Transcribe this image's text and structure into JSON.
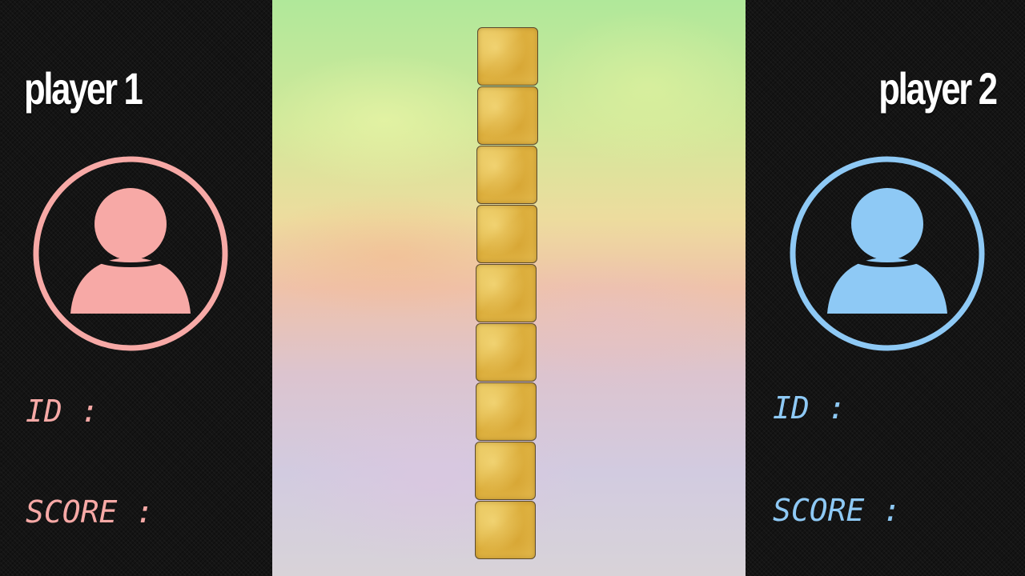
{
  "player1": {
    "title": "player 1",
    "id_label": "ID :",
    "score_label": "SCORE :",
    "color": "#f7a9a6",
    "avatar_icon": "user-avatar-icon"
  },
  "player2": {
    "title": "player 2",
    "id_label": "ID :",
    "score_label": "SCORE :",
    "color": "#8ec9f5",
    "avatar_icon": "user-avatar-icon"
  },
  "board": {
    "tile_count": 9,
    "tile_color": "#e0b545"
  }
}
